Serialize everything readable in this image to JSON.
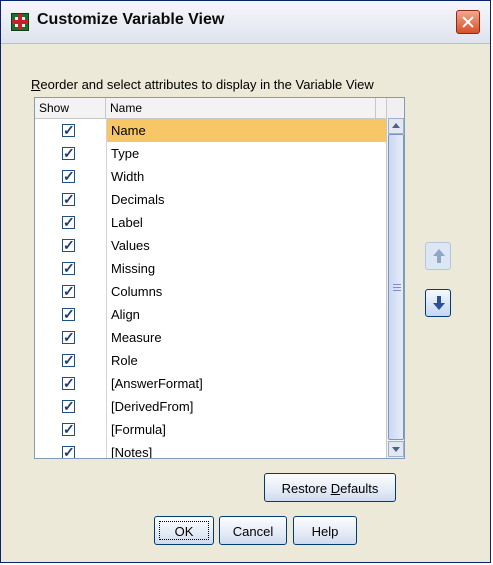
{
  "dialog": {
    "title": "Customize Variable View",
    "instruction_prefix": "R",
    "instruction_rest": "eorder and select attributes to display in the Variable View"
  },
  "list": {
    "headers": {
      "show": "Show",
      "name": "Name"
    },
    "rows": [
      {
        "label": "Name",
        "checked": true,
        "selected": true
      },
      {
        "label": "Type",
        "checked": true
      },
      {
        "label": "Width",
        "checked": true
      },
      {
        "label": "Decimals",
        "checked": true
      },
      {
        "label": "Label",
        "checked": true
      },
      {
        "label": "Values",
        "checked": true
      },
      {
        "label": "Missing",
        "checked": true
      },
      {
        "label": "Columns",
        "checked": true
      },
      {
        "label": "Align",
        "checked": true
      },
      {
        "label": "Measure",
        "checked": true
      },
      {
        "label": "Role",
        "checked": true
      },
      {
        "label": "[AnswerFormat]",
        "checked": true
      },
      {
        "label": "[DerivedFrom]",
        "checked": true
      },
      {
        "label": "[Formula]",
        "checked": true
      },
      {
        "label": "[Notes]",
        "checked": true
      }
    ]
  },
  "buttons": {
    "restore_prefix": "Restore ",
    "restore_accel": "D",
    "restore_rest": "efaults",
    "ok": "OK",
    "cancel": "Cancel",
    "help": "Help"
  },
  "colors": {
    "selection": "#f7c665",
    "border": "#7f9db9"
  },
  "icons": {
    "move_up": "arrow-up-icon",
    "move_down": "arrow-down-icon"
  }
}
